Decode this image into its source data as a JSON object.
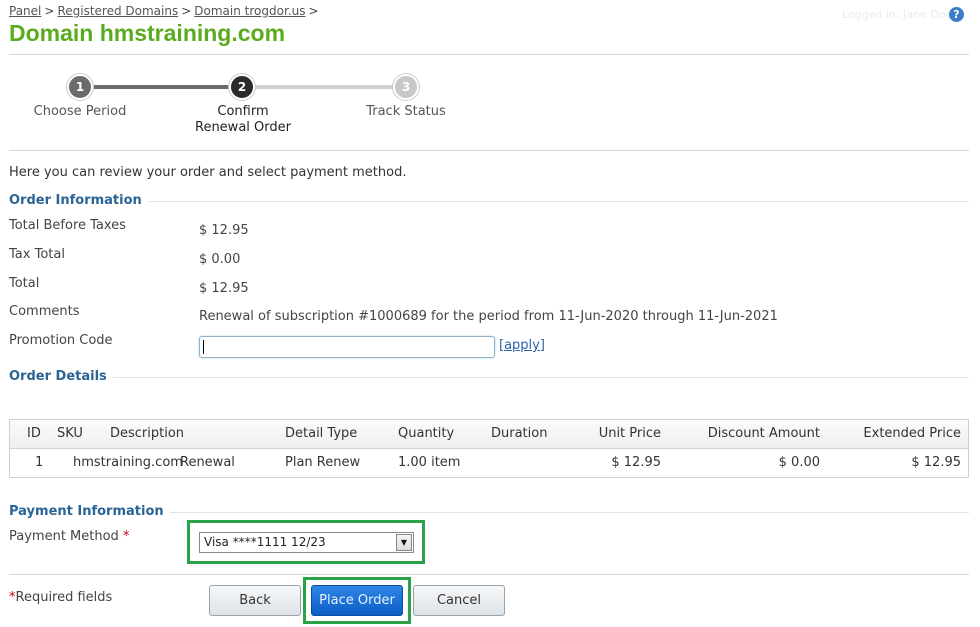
{
  "breadcrumb": {
    "items": [
      "Panel",
      "Registered Domains",
      "Domain trogdor.us"
    ],
    "separator": ">"
  },
  "header": {
    "title": "Domain hmstraining.com",
    "faint_text": "Logged in: Jane Doe"
  },
  "wizard": {
    "steps": [
      {
        "number": "1",
        "label": "Choose Period",
        "state": "done"
      },
      {
        "number": "2",
        "label": "Confirm Renewal Order",
        "state": "active"
      },
      {
        "number": "3",
        "label": "Track Status",
        "state": "pending"
      }
    ]
  },
  "intro": "Here you can review your order and select payment method.",
  "order_information": {
    "title": "Order Information",
    "rows": [
      {
        "label": "Total Before Taxes",
        "value": "$ 12.95"
      },
      {
        "label": "Tax Total",
        "value": "$ 0.00"
      },
      {
        "label": "Total",
        "value": "$ 12.95"
      },
      {
        "label": "Comments",
        "value": "Renewal of subscription #1000689 for the period from 11-Jun-2020 through 11-Jun-2021"
      }
    ],
    "promotion_label": "Promotion Code",
    "promotion_value": "",
    "apply_label": "[apply]"
  },
  "order_details": {
    "title": "Order Details",
    "columns": [
      "ID",
      "SKU",
      "Description",
      "Detail Type",
      "Quantity",
      "Duration",
      "Unit Price",
      "Discount Amount",
      "Extended Price"
    ],
    "rows": [
      [
        "1",
        "hmstraining.com",
        "Renewal",
        "Plan Renew",
        "1.00 item",
        "",
        "$ 12.95",
        "$ 0.00",
        "$ 12.95"
      ]
    ]
  },
  "payment": {
    "title": "Payment Information",
    "method_label": "Payment Method",
    "required_mark": "*",
    "selected": "Visa ****1111 12/23"
  },
  "footer": {
    "required_note": "Required fields",
    "required_mark": "*",
    "back": "Back",
    "place_order": "Place Order",
    "cancel": "Cancel"
  },
  "colors": {
    "title_green": "#5aab1e",
    "section_blue": "#2a6494",
    "highlight_green": "#2aa348",
    "primary_blue": "#0d5ec4"
  },
  "icons": {
    "help": "help-circle-icon",
    "select_arrow": "chevron-down-icon"
  }
}
